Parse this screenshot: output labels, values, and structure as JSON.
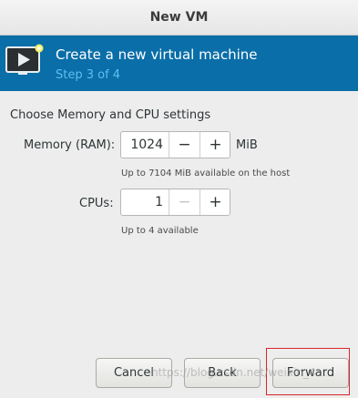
{
  "window": {
    "title": "New VM"
  },
  "banner": {
    "icon": "virtual-machine-play-icon",
    "title": "Create a new virtual machine",
    "step": "Step 3 of 4"
  },
  "form": {
    "heading": "Choose Memory and CPU settings",
    "memory": {
      "label": "Memory (RAM):",
      "value": "1024",
      "decrement": "−",
      "increment": "+",
      "unit": "MiB",
      "hint": "Up to 7104 MiB available on the host"
    },
    "cpus": {
      "label": "CPUs:",
      "value": "1",
      "decrement": "−",
      "increment": "+",
      "hint": "Up to 4 available"
    }
  },
  "footer": {
    "cancel_label": "Cancel",
    "back_label": "Back",
    "forward_label": "Forward"
  },
  "overlay": {
    "watermark": "https://blog.csdn.net/weixin_4..."
  },
  "colors": {
    "banner_bg": "#0a6ea8",
    "step_text": "#5ec0ee",
    "highlight": "#d9262b"
  }
}
